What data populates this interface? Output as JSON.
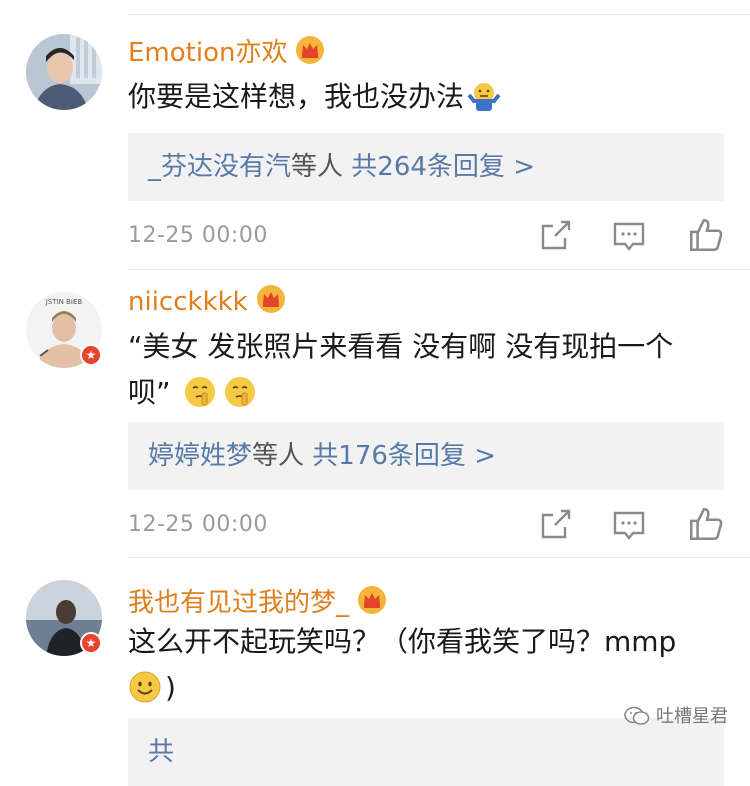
{
  "comments": [
    {
      "username": "Emotion亦欢",
      "content": "你要是这样想，我也没办法",
      "reply": {
        "names": "_芬达没有汽",
        "middle": "等人",
        "count": "共264条回复 >"
      },
      "time": "12-25 00:00"
    },
    {
      "username": "niicckkkk",
      "content_line1": "“美女 发张照片来看看 没有啊 没有现拍一个",
      "content_line2": "呗”",
      "reply": {
        "names": "婷婷姓梦",
        "middle": "等人",
        "count": "共176条回复 >"
      },
      "time": "12-25 00:00"
    },
    {
      "username": "我也有见过我的梦_",
      "content_line1": "这么开不起玩笑吗？（你看我笑了吗？mmp",
      "content_line2": ")",
      "reply": {
        "names": "",
        "middle": "",
        "count": "共"
      }
    }
  ],
  "watermark": "吐槽星君",
  "icons": {
    "vip": "crown-vip-icon",
    "share": "share-icon",
    "comment": "comment-icon",
    "like": "thumbs-up-icon",
    "verified": "verified-star-badge"
  },
  "colors": {
    "username": "#e07f1c",
    "reply_link": "#587aa8",
    "time": "#9b9b9b",
    "badge": "#e8432f"
  }
}
